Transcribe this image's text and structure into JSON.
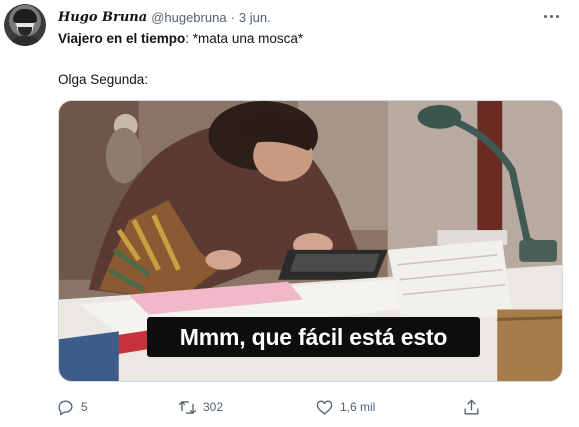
{
  "tweet": {
    "display_name": "Hugo Bruna",
    "handle": "@hugebruna",
    "separator": "·",
    "date": "3 jun.",
    "text_line1_bold": "Viajero en el tiempo",
    "text_line1_rest": ": *mata una mosca*",
    "text_line2": "Olga Segunda:",
    "media": {
      "subtitle": "Mmm, que fácil está esto"
    },
    "actions": {
      "replies": "5",
      "retweets": "302",
      "likes": "1,6 mil"
    }
  },
  "colors": {
    "text": "#0f1419",
    "secondary": "#536471",
    "border": "#cfd9de"
  },
  "icons": [
    "more-icon",
    "reply-icon",
    "retweet-icon",
    "like-icon",
    "share-icon"
  ]
}
